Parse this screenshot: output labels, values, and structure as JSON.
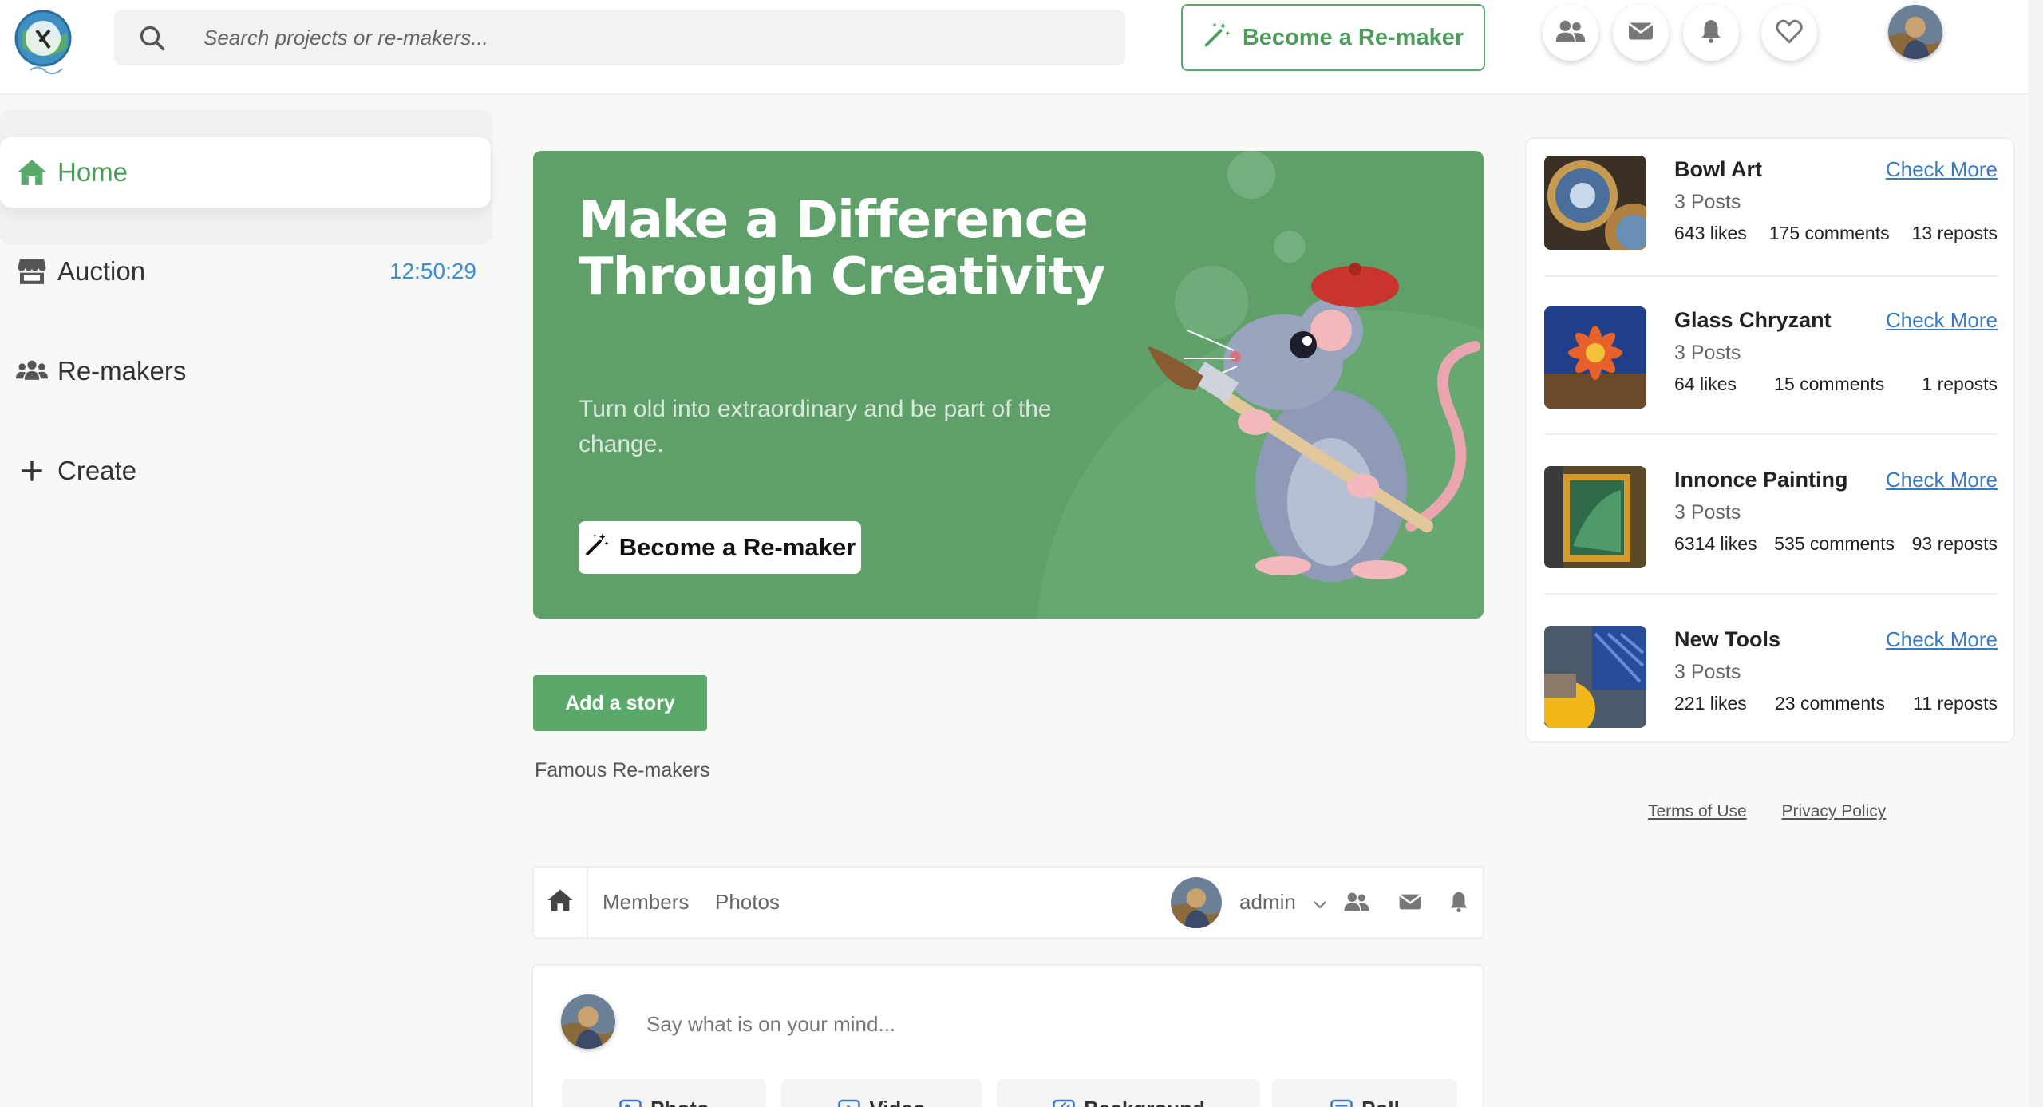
{
  "search": {
    "placeholder": "Search projects or re-makers..."
  },
  "topbar": {
    "become_label": "Become a Re-maker",
    "icons": [
      "people-icon",
      "mail-icon",
      "bell-icon",
      "heart-icon"
    ]
  },
  "sidebar": {
    "items": [
      {
        "label": "Home",
        "icon": "home-icon",
        "active": true
      },
      {
        "label": "Auction",
        "icon": "store-icon",
        "timer": "12:50:29"
      },
      {
        "label": "Re-makers",
        "icon": "people-icon"
      },
      {
        "label": "Create",
        "icon": "plus-icon"
      }
    ]
  },
  "hero": {
    "title": "Make a Difference Through Creativity",
    "subtitle": "Turn old into extraordinary and be part of the change.",
    "button_label": "Become a Re-maker"
  },
  "main": {
    "add_story_label": "Add a story",
    "famous_label": "Famous Re-makers"
  },
  "subnav": {
    "links": [
      "Members",
      "Photos"
    ],
    "user": "admin"
  },
  "composer": {
    "placeholder": "Say what is on your mind...",
    "buttons": [
      "Photo",
      "Video",
      "Background",
      "Poll"
    ]
  },
  "projects": [
    {
      "title": "Bowl Art",
      "posts": "3 Posts",
      "likes": "643 likes",
      "comments": "175 comments",
      "reposts": "13 reposts",
      "link": "Check More"
    },
    {
      "title": "Glass Chryzant",
      "posts": "3 Posts",
      "likes": "64 likes",
      "comments": "15 comments",
      "reposts": "1 reposts",
      "link": "Check More"
    },
    {
      "title": "Innonce Painting",
      "posts": "3 Posts",
      "likes": "6314 likes",
      "comments": "535 comments",
      "reposts": "93 reposts",
      "link": "Check More"
    },
    {
      "title": "New Tools",
      "posts": "3 Posts",
      "likes": "221 likes",
      "comments": "23 comments",
      "reposts": "11 reposts",
      "link": "Check More"
    }
  ],
  "footer": {
    "terms": "Terms of Use",
    "privacy": "Privacy Policy"
  },
  "colors": {
    "brand_green": "#5aa86a",
    "hero_green": "#5e9f6a",
    "link_blue": "#3a7bbf",
    "timer_blue": "#3a8fd6"
  }
}
